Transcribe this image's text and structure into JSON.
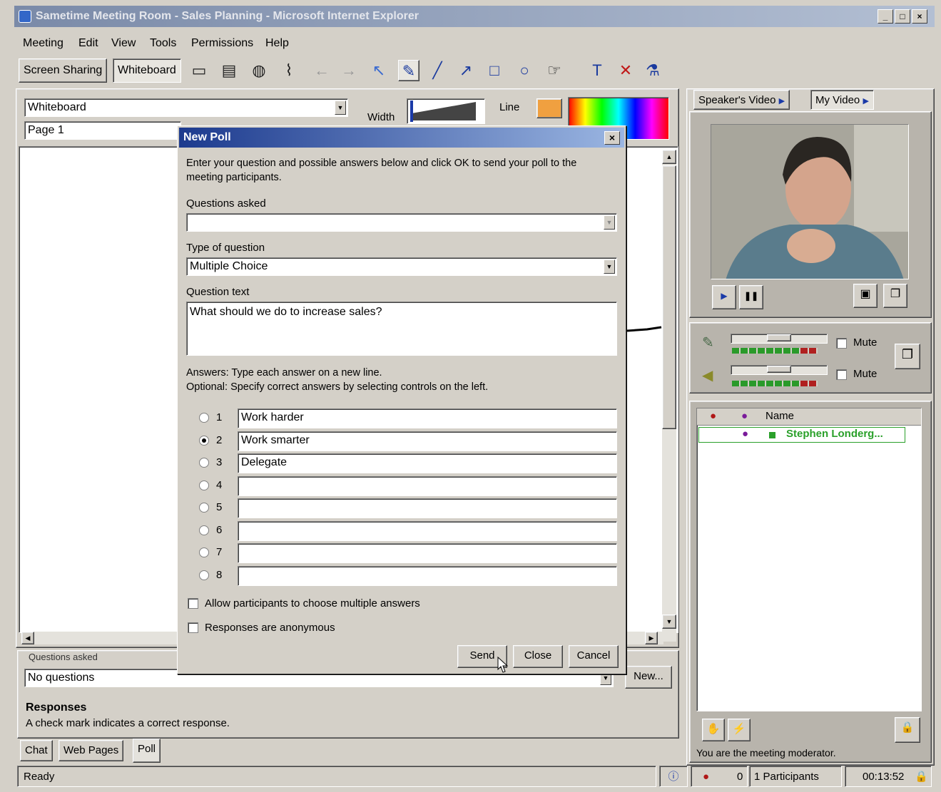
{
  "window": {
    "title": "Sametime Meeting Room - Sales Planning - Microsoft Internet Explorer",
    "min": "_",
    "max": "□",
    "close": "×"
  },
  "menu": [
    "Meeting",
    "Edit",
    "View",
    "Tools",
    "Permissions",
    "Help"
  ],
  "toolbar": {
    "screen_sharing": "Screen Sharing",
    "whiteboard": "Whiteboard",
    "text_tool": "T"
  },
  "whiteboard": {
    "mode_select": "Whiteboard",
    "page_select": "Page 1",
    "width_label": "Width",
    "line_label": "Line",
    "width_value": "3"
  },
  "poll_panel": {
    "questions_asked_label": "Questions asked",
    "questions_select": "No questions",
    "new_button": "New...",
    "responses_heading": "Responses",
    "responses_note": "A check mark indicates a correct response."
  },
  "bottom_tabs": [
    "Chat",
    "Web Pages",
    "Poll"
  ],
  "dialog": {
    "title": "New Poll",
    "intro": "Enter your question and possible answers below and click OK to send your poll to the meeting participants.",
    "questions_asked_label": "Questions asked",
    "questions_asked_value": "",
    "type_label": "Type of question",
    "type_value": "Multiple Choice",
    "question_text_label": "Question text",
    "question_text_value": "What should we do to increase sales?",
    "answers_line1": "Answers: Type each answer on a new line.",
    "answers_line2": "Optional: Specify correct answers by selecting controls on the left.",
    "answers": [
      {
        "num": "1",
        "text": "Work harder",
        "selected": false
      },
      {
        "num": "2",
        "text": "Work smarter",
        "selected": true
      },
      {
        "num": "3",
        "text": "Delegate",
        "selected": false
      },
      {
        "num": "4",
        "text": "",
        "selected": false
      },
      {
        "num": "5",
        "text": "",
        "selected": false
      },
      {
        "num": "6",
        "text": "",
        "selected": false
      },
      {
        "num": "7",
        "text": "",
        "selected": false
      },
      {
        "num": "8",
        "text": "",
        "selected": false
      }
    ],
    "allow_multiple_label": "Allow participants to choose multiple answers",
    "allow_multiple_checked": false,
    "anonymous_label": "Responses are anonymous",
    "anonymous_checked": false,
    "send_button": "Send",
    "close_button": "Close",
    "cancel_button": "Cancel",
    "close_x": "×"
  },
  "video": {
    "speakers_tab": "Speaker's Video",
    "my_video_tab": "My Video",
    "mute_label": "Mute",
    "mic_mute": false,
    "speaker_mute": false,
    "mic_level": 0.72,
    "speaker_level": 0.72
  },
  "participants": {
    "name_header": "Name",
    "rows": [
      {
        "name": "Stephen Londerg..."
      }
    ],
    "moderator_note": "You are the meeting moderator."
  },
  "status": {
    "text": "Ready",
    "hand_count": "0",
    "participants": "1 Participants",
    "time": "00:13:52"
  },
  "colors": {
    "title_active": "#1c3a8e",
    "participant_name": "#2aa02a",
    "meter_green": "#2a9a2a",
    "meter_red": "#b02020"
  }
}
